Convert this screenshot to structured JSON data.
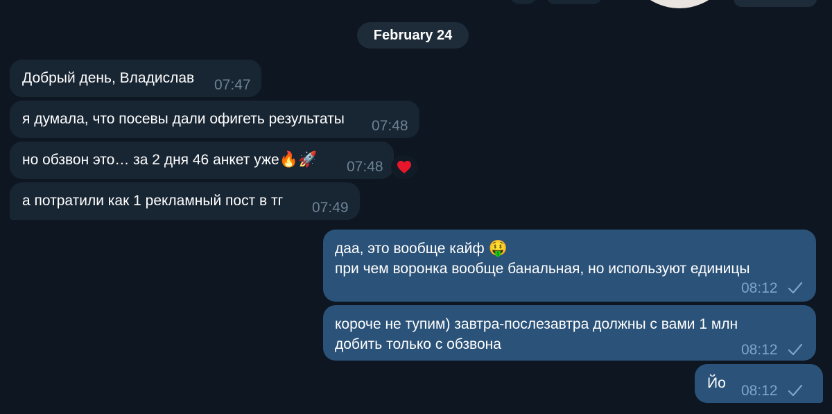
{
  "date_separator": "February 24",
  "incoming": [
    {
      "text": "Добрый день, Владислав",
      "time": "07:47"
    },
    {
      "text": "я думала, что посевы дали офигеть результаты",
      "time": "07:48"
    },
    {
      "text": "но обзвон это… за 2 дня 46 анкет уже",
      "emoji": "🔥🚀",
      "time": "07:48",
      "reaction": "❤️"
    },
    {
      "text": "а потратили как 1 рекламный пост в тг",
      "time": "07:49"
    }
  ],
  "outgoing": [
    {
      "line1": "даа, это вообще кайф",
      "emoji": "🤑",
      "line2": "при чем воронка вообще банальная, но используют единицы",
      "time": "08:12",
      "status": "check-icon"
    },
    {
      "line1": "короче не тупим) завтра-послезавтра должны с вами 1 млн",
      "line2": "добить только с обзвона",
      "time": "08:12",
      "status": "check-icon"
    },
    {
      "text": "Йо",
      "time": "08:12",
      "status": "check-icon"
    }
  ],
  "colors": {
    "background": "#0e1621",
    "incoming_bubble": "#182533",
    "outgoing_bubble": "#2b5278",
    "date_pill": "#1e2c3a",
    "incoming_time": "#6d8396",
    "outgoing_time": "#7ba6cf"
  }
}
